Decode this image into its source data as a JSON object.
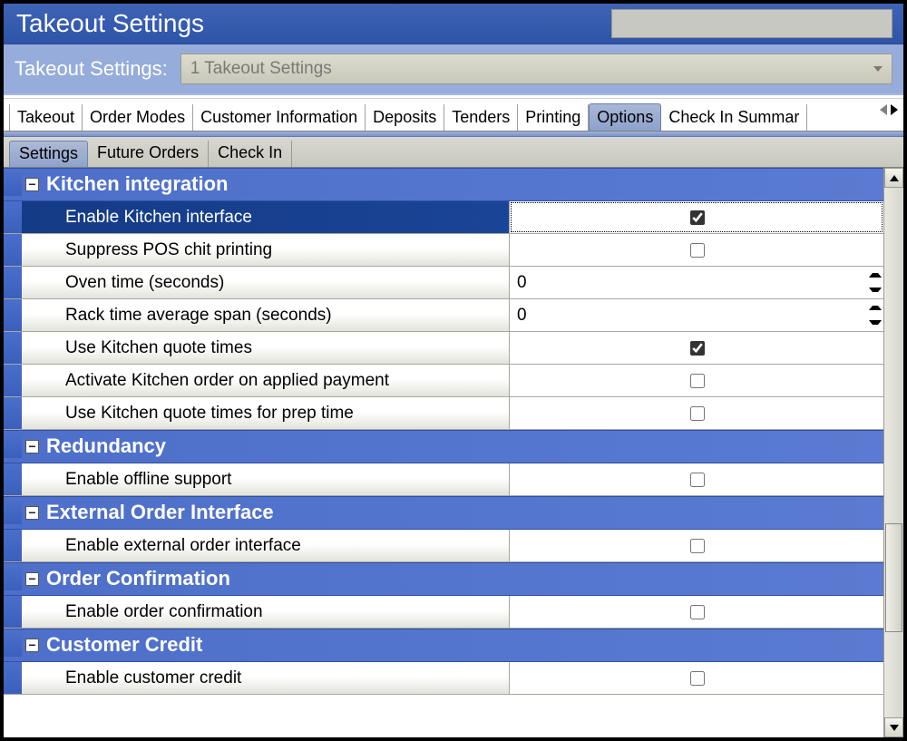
{
  "titlebar": {
    "title": "Takeout Settings"
  },
  "selector": {
    "label": "Takeout Settings:",
    "value": "1 Takeout Settings"
  },
  "top_tabs": [
    "Takeout",
    "Order Modes",
    "Customer Information",
    "Deposits",
    "Tenders",
    "Printing",
    "Options",
    "Check In Summar"
  ],
  "top_tab_active": "Options",
  "sub_tabs": [
    "Settings",
    "Future Orders",
    "Check In"
  ],
  "sub_tab_active": "Settings",
  "groups": [
    {
      "title": "Kitchen integration",
      "rows": [
        {
          "label": "Enable Kitchen interface",
          "type": "check",
          "value": true,
          "selected": true
        },
        {
          "label": "Suppress POS chit printing",
          "type": "check",
          "value": false
        },
        {
          "label": "Oven time (seconds)",
          "type": "number",
          "value": "0"
        },
        {
          "label": "Rack time average span (seconds)",
          "type": "number",
          "value": "0"
        },
        {
          "label": "Use Kitchen quote times",
          "type": "check",
          "value": true
        },
        {
          "label": "Activate Kitchen order on applied payment",
          "type": "check",
          "value": false
        },
        {
          "label": "Use Kitchen quote times for prep time",
          "type": "check",
          "value": false
        }
      ]
    },
    {
      "title": "Redundancy",
      "rows": [
        {
          "label": "Enable offline support",
          "type": "check",
          "value": false
        }
      ]
    },
    {
      "title": "External Order Interface",
      "rows": [
        {
          "label": "Enable external order interface",
          "type": "check",
          "value": false
        }
      ]
    },
    {
      "title": "Order Confirmation",
      "rows": [
        {
          "label": "Enable order confirmation",
          "type": "check",
          "value": false
        }
      ]
    },
    {
      "title": "Customer Credit",
      "rows": [
        {
          "label": "Enable customer credit",
          "type": "check",
          "value": false
        }
      ]
    }
  ]
}
